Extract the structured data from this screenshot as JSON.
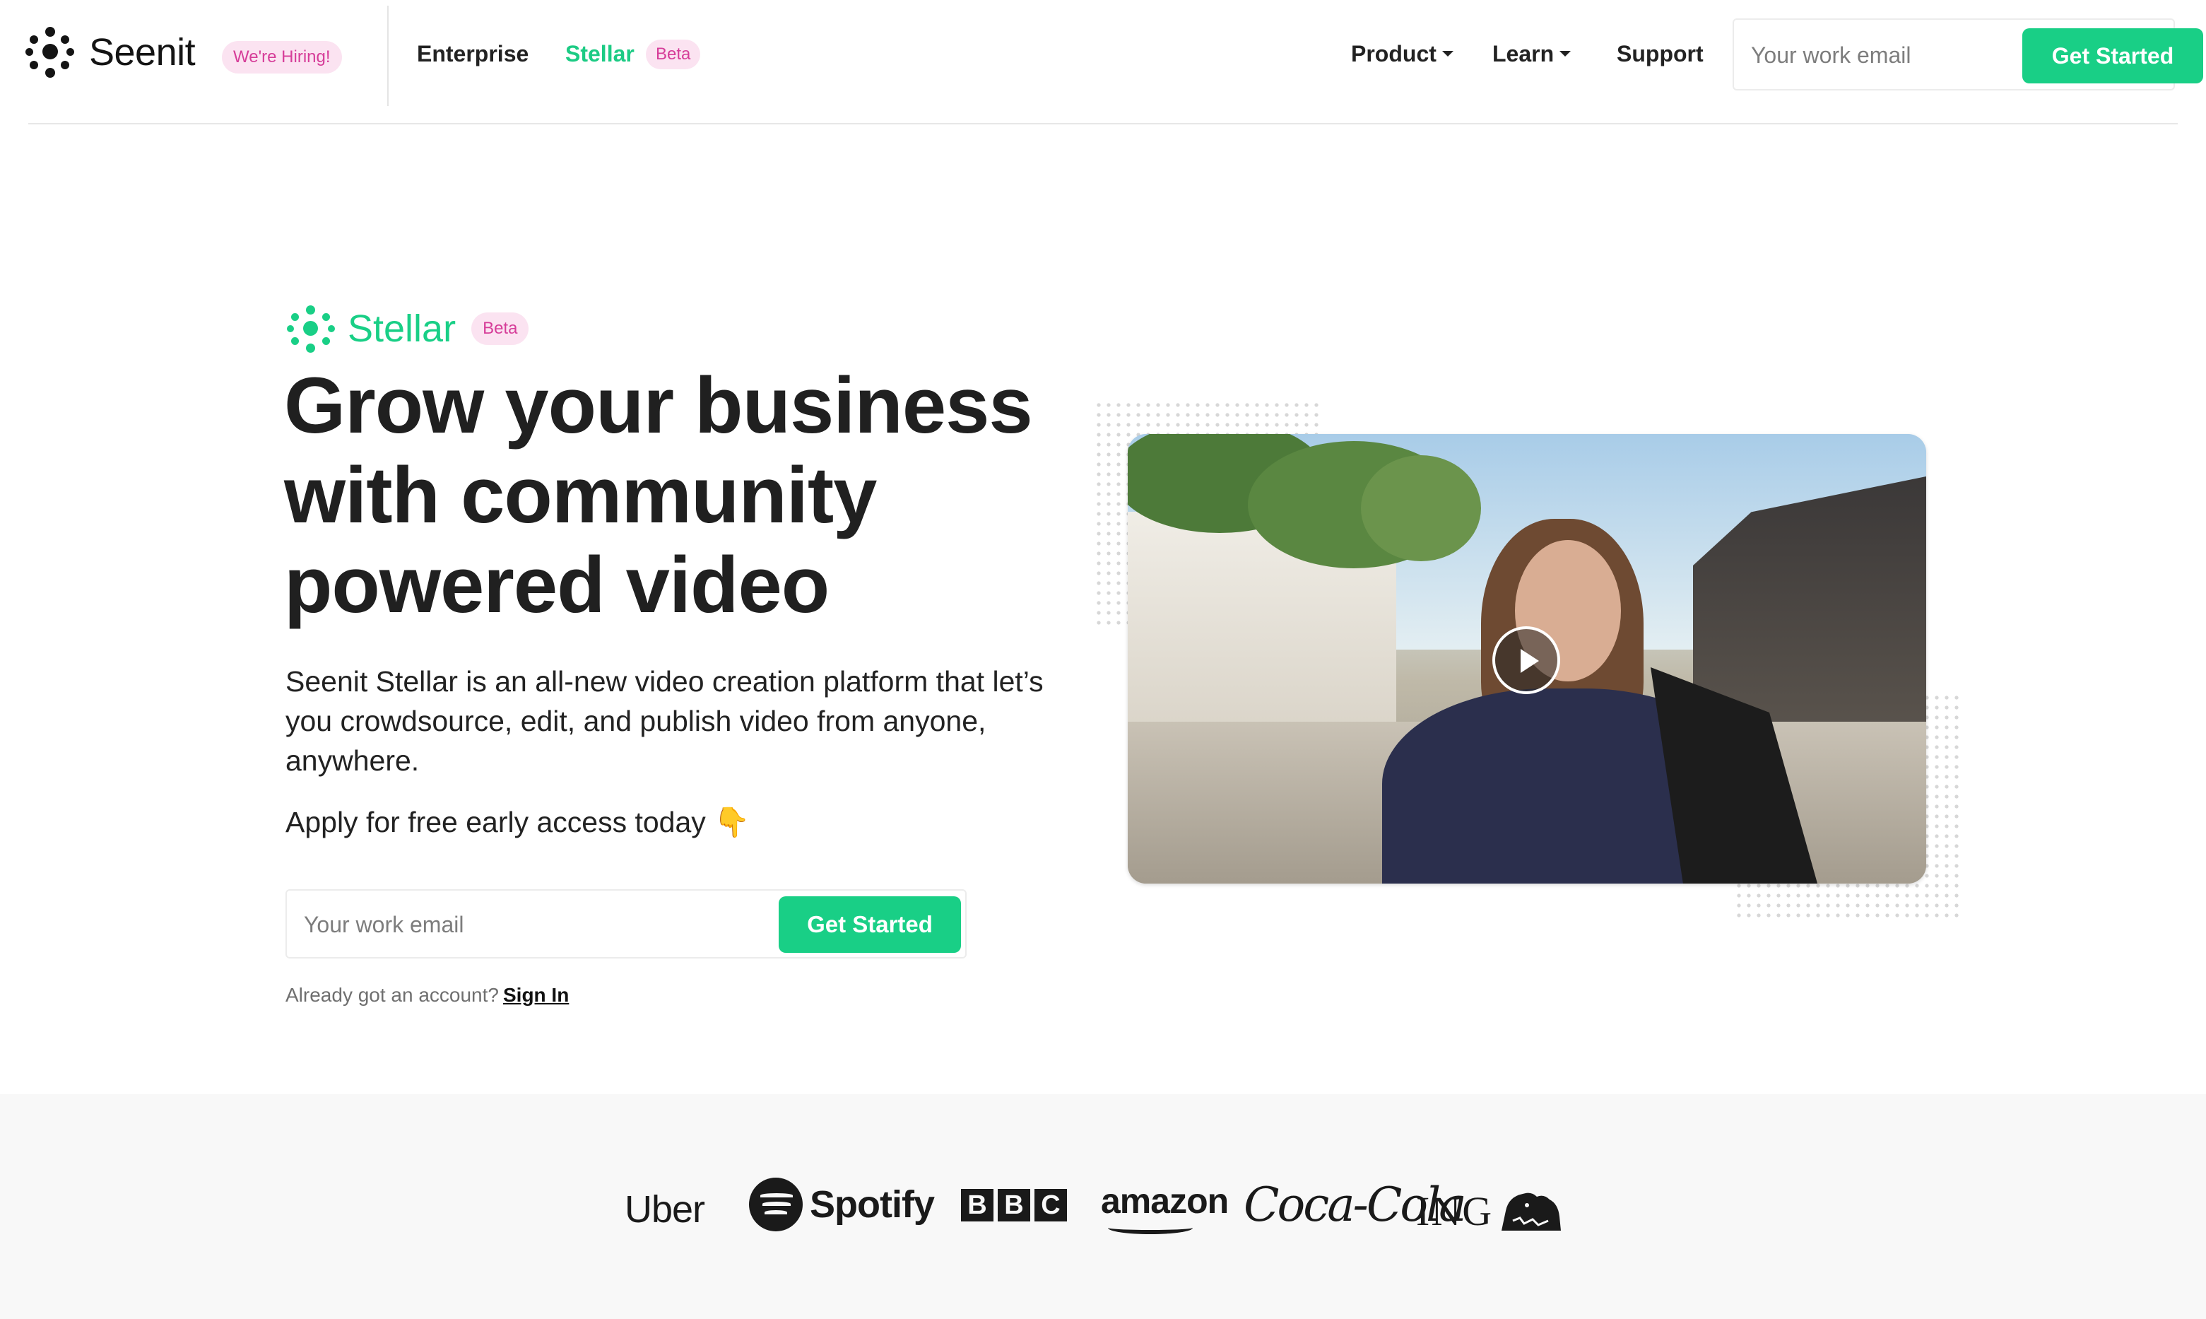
{
  "nav": {
    "brand": "Seenit",
    "hiring_badge": "We're Hiring!",
    "links": {
      "enterprise": "Enterprise",
      "stellar": "Stellar",
      "stellar_badge": "Beta",
      "product": "Product",
      "learn": "Learn",
      "support": "Support"
    },
    "email_placeholder": "Your work email",
    "cta": "Get Started"
  },
  "hero": {
    "brand": "Stellar",
    "badge": "Beta",
    "headline": "Grow your business with community powered video",
    "subtitle": "Seenit Stellar is an all-new video creation platform that let’s you crowdsource, edit, and publish video from anyone, anywhere.",
    "apply_text": "Apply for free early access today 👇",
    "email_placeholder": "Your work email",
    "cta": "Get Started",
    "already_text": "Already got an account?",
    "sign_in": "Sign In"
  },
  "video": {
    "play_icon": "play-icon"
  },
  "logos": {
    "uber": "Uber",
    "spotify": "Spotify",
    "bbc": [
      "B",
      "B",
      "C"
    ],
    "amazon": "amazon",
    "cocacola": "Coca-Cola",
    "ing": "ING"
  },
  "colors": {
    "accent": "#19cf86",
    "badge_bg": "#fbe3f1",
    "badge_text": "#d63d99",
    "text": "#202020",
    "logo_band": "#f8f8f8"
  }
}
